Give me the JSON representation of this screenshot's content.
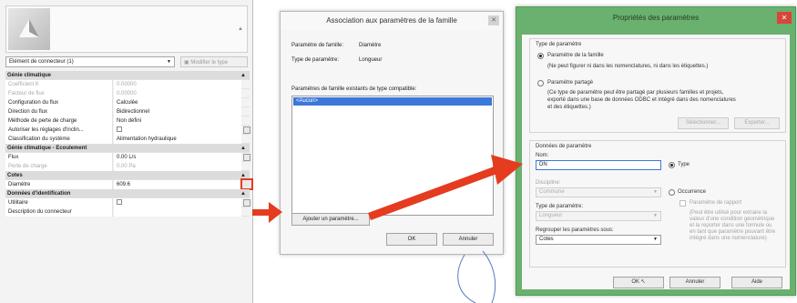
{
  "properties": {
    "type_selector": "Elément de connecteur (1)",
    "edit_type": "Modifier le type",
    "groups": [
      {
        "title": "Génie climatique",
        "rows": [
          {
            "name": "Coefficient K",
            "value": "0.00000",
            "dim": true
          },
          {
            "name": "Facteur de flux",
            "value": "0.00000",
            "dim": true
          },
          {
            "name": "Configuration du flux",
            "value": "Calculée"
          },
          {
            "name": "Direction du flux",
            "value": "Bidirectionnel"
          },
          {
            "name": "Méthode de perte de charge",
            "value": "Non défini"
          },
          {
            "name": "Autoriser les réglages d'inclin...",
            "value": "",
            "checkbox": true
          },
          {
            "name": "Classification du système",
            "value": "Alimentation hydraulique"
          }
        ]
      },
      {
        "title": "Génie climatique - Ecoulement",
        "rows": [
          {
            "name": "Flux",
            "value": "0.00 L/s"
          },
          {
            "name": "Perte de charge",
            "value": "0.00 Pa",
            "dim": true
          }
        ]
      },
      {
        "title": "Cotes",
        "rows": [
          {
            "name": "Diamètre",
            "value": "609.6"
          }
        ]
      },
      {
        "title": "Données d'identification",
        "rows": [
          {
            "name": "Utilitaire",
            "value": "",
            "checkbox": true
          },
          {
            "name": "Description du connecteur",
            "value": ""
          }
        ]
      }
    ]
  },
  "association_dialog": {
    "title": "Association aux paramètres de la famille",
    "family_param_label": "Paramètre de famille:",
    "family_param_value": "Diamètre",
    "param_type_label": "Type de paramètre:",
    "param_type_value": "Longueur",
    "list_label": "Paramètres de famille existants de type compatible:",
    "list_items": [
      "<Aucun>"
    ],
    "add_param": "Ajouter un paramètre...",
    "ok": "OK",
    "cancel": "Annuler",
    "close": "✕"
  },
  "param_dialog": {
    "title": "Propriétés des paramètres",
    "close": "✕",
    "type_section": "Type de paramètre",
    "family_param": "Paramètre de la famille",
    "family_param_desc": "(Ne peut figurer ni dans les nomenclatures, ni dans les étiquettes.)",
    "shared_param": "Paramètre partagé",
    "shared_param_desc": [
      "(Ce type de paramètre peut être partagé par plusieurs familles et projets,",
      "exporté dans une base de données ODBC et intégré dans des nomenclatures",
      "et des étiquettes.)"
    ],
    "select": "Sélectionner...",
    "export": "Exporter...",
    "data_section": "Données de paramètre",
    "name_label": "Nom:",
    "name_value": "DN",
    "type_radio": "Type",
    "instance_radio": "Occurrence",
    "discipline_label": "Discipline:",
    "discipline_value": "Commune",
    "param_type_label": "Type de paramètre:",
    "param_type_value": "Longueur",
    "group_label": "Regrouper les paramètres sous:",
    "group_value": "Cotes",
    "report_param": "Paramètre de rapport",
    "report_desc": [
      "(Peut être utilisé pour extraire la",
      "valeur d'une condition géométrique",
      "et la reporter dans une formule ou",
      "en tant que paramètre pouvant être",
      "intégré dans une nomenclature)"
    ],
    "ok": "OK",
    "cancel": "Annuler",
    "help": "Aide"
  },
  "colors": {
    "accent_green": "#6ab06e",
    "arrow_red": "#e53b1f",
    "selection_blue": "#3c78d8"
  }
}
